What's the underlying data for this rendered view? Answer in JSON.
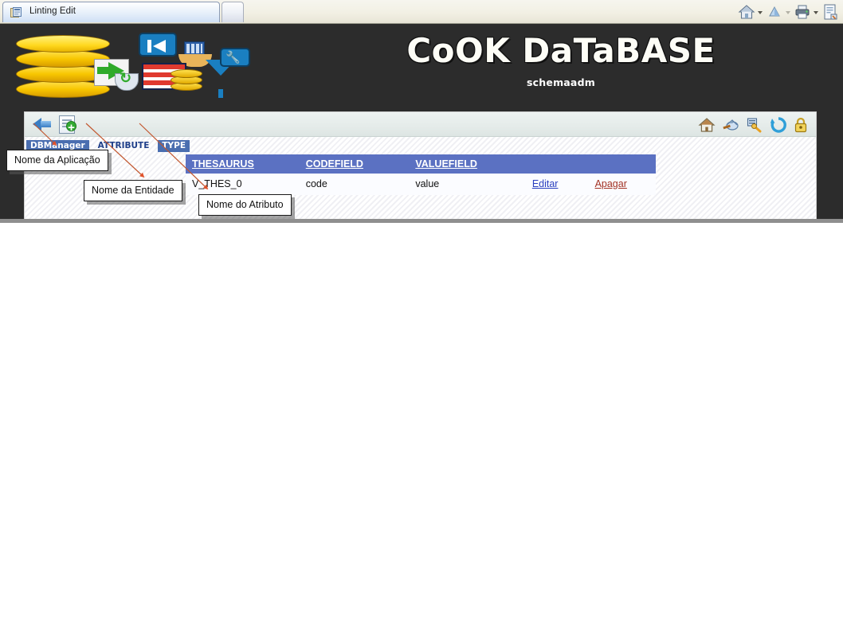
{
  "browser": {
    "active_tab": {
      "title": "Linting Edit",
      "favicon_icon": "page-icon"
    },
    "new_tab_label": "",
    "toolbar_icons": [
      {
        "name": "home-icon",
        "glyph": "⌂"
      },
      {
        "name": "home-dropdown-caret",
        "glyph": ""
      },
      {
        "name": "feeds-icon",
        "glyph": "⊕"
      },
      {
        "name": "feeds-dropdown-caret",
        "glyph": ""
      },
      {
        "name": "print-icon",
        "glyph": "⎙"
      },
      {
        "name": "print-dropdown-caret",
        "glyph": ""
      },
      {
        "name": "page-tools-icon",
        "glyph": "☰"
      }
    ]
  },
  "banner": {
    "title": "CoOK DaTaBASE",
    "subtitle": "schemaadm",
    "art_icons": [
      "database-cylinder-icon",
      "document-export-icon",
      "recycle-icon",
      "first-record-icon",
      "grid-table-icon",
      "hands-icon",
      "red-table-icon",
      "coins-icon",
      "filter-funnel-icon",
      "wrench-icon"
    ]
  },
  "toolbar": {
    "back_icon": "back-arrow-icon",
    "new_icon": "new-document-icon",
    "right_icons": [
      {
        "name": "home-icon",
        "glyph": "🏠"
      },
      {
        "name": "paint-bucket-icon",
        "glyph": "🪣"
      },
      {
        "name": "tools-icon",
        "glyph": "🔧"
      },
      {
        "name": "refresh-icon",
        "glyph": "⟳"
      },
      {
        "name": "lock-icon",
        "glyph": "🔒"
      }
    ]
  },
  "breadcrumb": [
    {
      "label": "DBManager",
      "selected": true
    },
    {
      "label": "ATTRIBUTE",
      "selected": false
    },
    {
      "label": "TYPE",
      "selected": true
    }
  ],
  "table": {
    "columns": [
      "THESAURUS",
      "CODEFIELD",
      "VALUEFIELD",
      "",
      ""
    ],
    "rows": [
      {
        "thesaurus": "V_THES_0",
        "codefield": "code",
        "valuefield": "value",
        "edit_label": "Editar",
        "delete_label": "Apagar"
      }
    ]
  },
  "annotations": [
    {
      "text": "Nome da Aplicação"
    },
    {
      "text": "Nome da Entidade"
    },
    {
      "text": "Nome do Atributo"
    }
  ],
  "colors": {
    "banner_bg": "#2c2c2c",
    "crumb_selected_bg": "#4a6eb0",
    "table_header_bg": "#5b71c2",
    "link_edit": "#2a3fbf",
    "link_delete": "#a33224",
    "annotation_arrow": "#e0522a"
  }
}
